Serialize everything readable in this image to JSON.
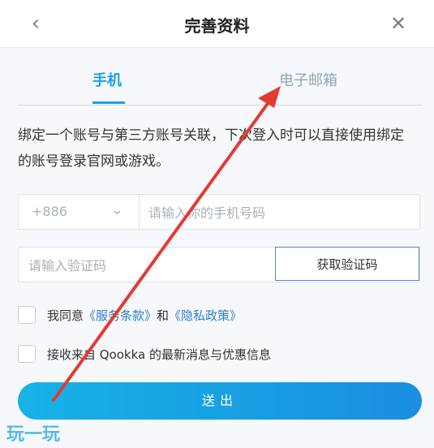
{
  "header": {
    "title": "完善资料",
    "back_icon": "chevron-left-icon",
    "close_icon": "close-icon"
  },
  "tabs": [
    {
      "label": "手机",
      "active": true
    },
    {
      "label": "电子邮箱",
      "active": false
    }
  ],
  "description": "绑定一个账号与第三方账号关联，下次登入时可以直接使用绑定的账号登录官网或游戏。",
  "phone": {
    "country_code": "+886",
    "placeholder": "请输入你的手机号码"
  },
  "verification": {
    "placeholder": "请输入验证码",
    "button_label": "获取验证码"
  },
  "agreements": {
    "terms_prefix": "我同意",
    "terms_link": "《服务条款》",
    "and": "和",
    "privacy_link": "《隐私政策》",
    "newsletter": "接收来自 Qookka 的最新消息与优惠信息"
  },
  "submit_label": "送出",
  "watermark": "玩一玩",
  "colors": {
    "accent": "#1da1e6",
    "annotation_arrow": "#e53935"
  }
}
